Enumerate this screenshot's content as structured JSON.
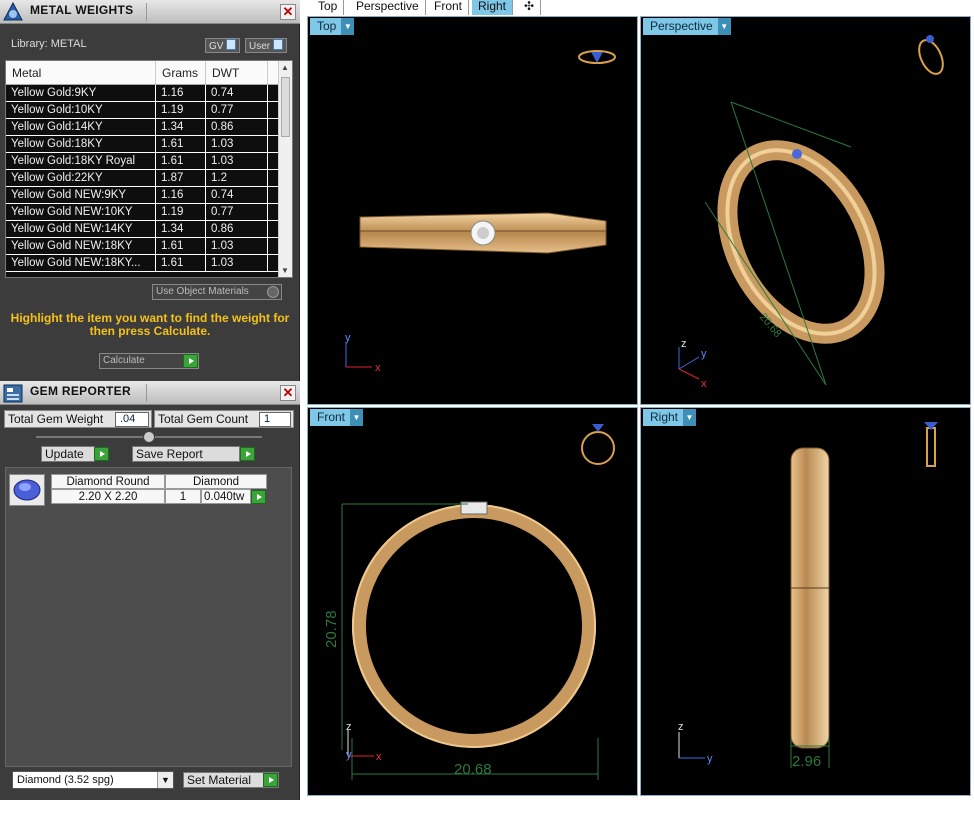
{
  "metal_weights": {
    "title": "METAL WEIGHTS",
    "library_label": "Library: METAL",
    "gv_label": "GV",
    "user_label": "User",
    "columns": [
      "Metal",
      "Grams",
      "DWT"
    ],
    "rows": [
      [
        "Yellow Gold:9KY",
        "1.16",
        "0.74"
      ],
      [
        "Yellow Gold:10KY",
        "1.19",
        "0.77"
      ],
      [
        "Yellow Gold:14KY",
        "1.34",
        "0.86"
      ],
      [
        "Yellow Gold:18KY",
        "1.61",
        "1.03"
      ],
      [
        "Yellow Gold:18KY Royal",
        "1.61",
        "1.03"
      ],
      [
        "Yellow Gold:22KY",
        "1.87",
        "1.2"
      ],
      [
        "Yellow Gold NEW:9KY",
        "1.16",
        "0.74"
      ],
      [
        "Yellow Gold NEW:10KY",
        "1.19",
        "0.77"
      ],
      [
        "Yellow Gold NEW:14KY",
        "1.34",
        "0.86"
      ],
      [
        "Yellow Gold NEW:18KY",
        "1.61",
        "1.03"
      ],
      [
        "Yellow Gold NEW:18KY...",
        "1.61",
        "1.03"
      ]
    ],
    "use_object_materials": "Use Object Materials",
    "hint": "Highlight the item you want to find the weight for then press Calculate.",
    "calculate_label": "Calculate"
  },
  "gem_reporter": {
    "title": "GEM REPORTER",
    "total_weight_label": "Total Gem Weight",
    "total_weight_value": ".04",
    "total_count_label": "Total Gem Count",
    "total_count_value": "1",
    "update_label": "Update",
    "save_report_label": "Save Report",
    "gem": {
      "shape": "Diamond Round",
      "material": "Diamond",
      "size": "2.20 X 2.20",
      "count": "1",
      "weight": "0.040tw"
    },
    "material_select": "Diamond    (3.52 spg)",
    "set_material_label": "Set Material"
  },
  "tabs": [
    "Top",
    "Perspective",
    "Front",
    "Right"
  ],
  "active_tab": "Right",
  "viewports": {
    "top": {
      "label": "Top"
    },
    "perspective": {
      "label": "Perspective",
      "dimension": "20.68"
    },
    "front": {
      "label": "Front",
      "height_dim": "20.78",
      "width_dim": "20.68"
    },
    "right": {
      "label": "Right",
      "width_dim": "2.96"
    }
  },
  "colors": {
    "gold": "#d4a56a",
    "viewport_label": "#7ec7e6",
    "hint": "#f5c21b",
    "dimension": "#3a9a4a"
  }
}
